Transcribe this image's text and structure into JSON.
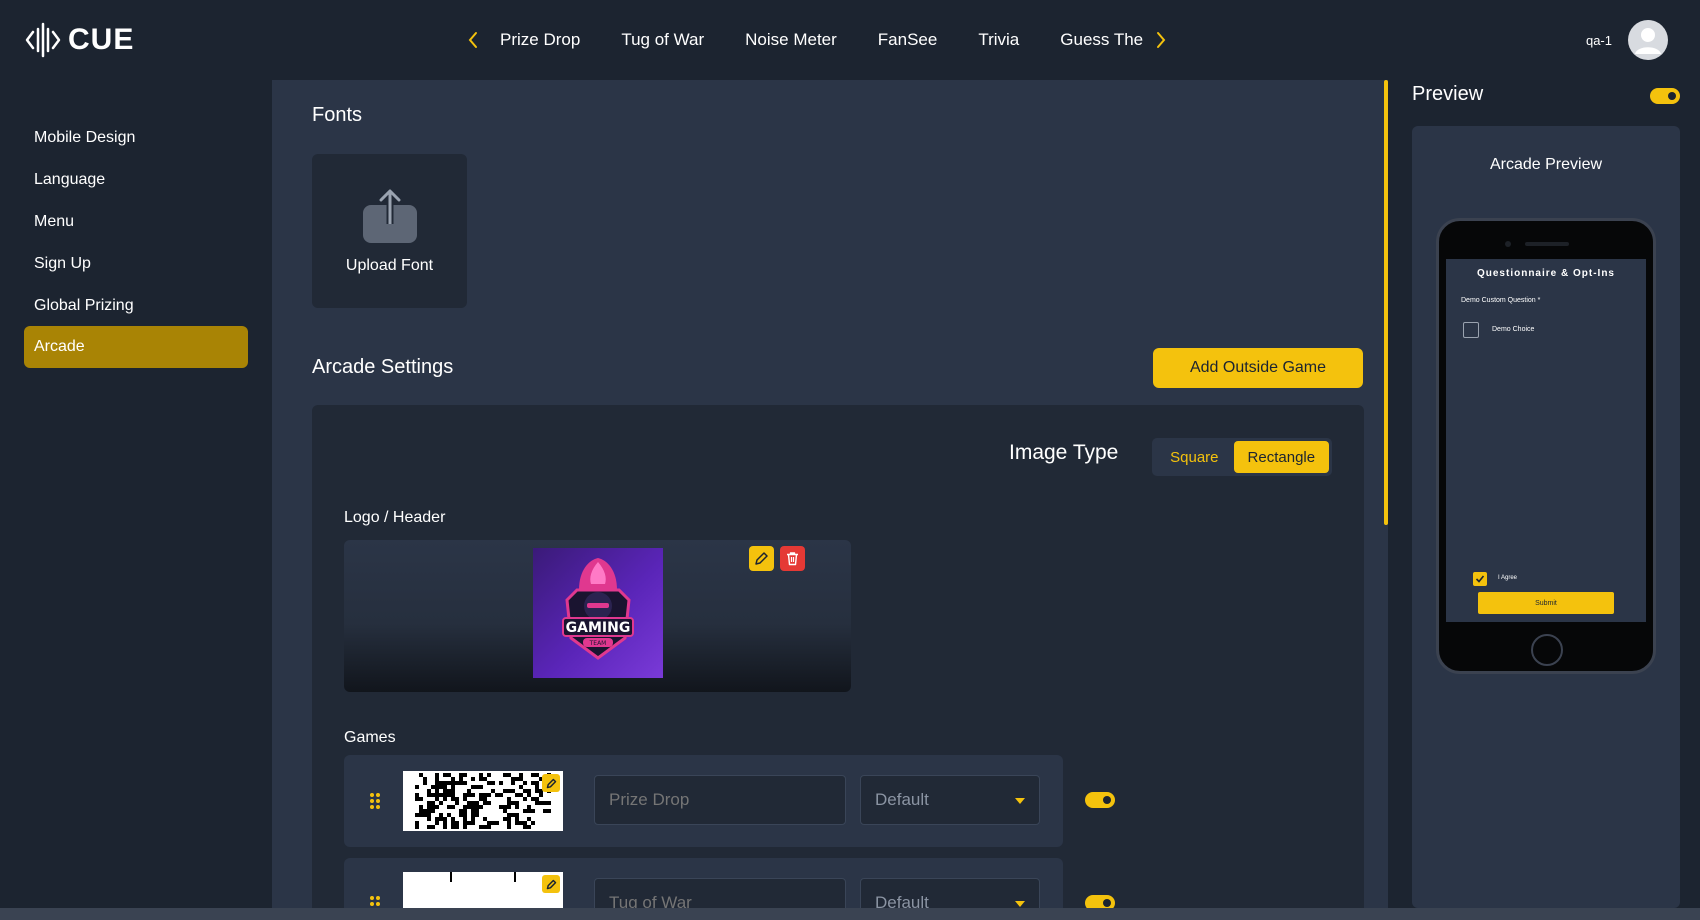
{
  "brand": {
    "name": "CUE"
  },
  "game_nav": {
    "items": [
      "Prize Drop",
      "Tug of War",
      "Noise Meter",
      "FanSee",
      "Trivia",
      "Guess The Score"
    ]
  },
  "user": {
    "name": "qa-1"
  },
  "sidebar": {
    "items": [
      {
        "label": "Mobile Design"
      },
      {
        "label": "Language"
      },
      {
        "label": "Menu"
      },
      {
        "label": "Sign Up"
      },
      {
        "label": "Global Prizing"
      },
      {
        "label": "Arcade",
        "active": true
      }
    ]
  },
  "fonts": {
    "title": "Fonts",
    "upload_label": "Upload Font"
  },
  "arcade": {
    "title": "Arcade Settings",
    "add_button": "Add Outside Game",
    "image_type": {
      "label": "Image Type",
      "options": [
        "Square",
        "Rectangle"
      ],
      "selected": "Rectangle"
    },
    "logo_header_label": "Logo / Header",
    "games_label": "Games",
    "games": [
      {
        "name_placeholder": "Prize Drop",
        "select_value": "Default",
        "enabled": true
      },
      {
        "name_placeholder": "Tug of War",
        "select_value": "Default",
        "enabled": true
      }
    ]
  },
  "preview": {
    "title": "Preview",
    "enabled": true,
    "card_title": "Arcade Preview",
    "screen": {
      "title": "Questionnaire & Opt-Ins",
      "question": "Demo Custom Question *",
      "choice": "Demo Choice",
      "agree": "I Agree",
      "submit": "Submit"
    }
  },
  "colors": {
    "accent": "#f4c20d",
    "active_sidebar": "#a98405",
    "background": "#1c2430",
    "panel": "#2b3547",
    "card": "#212936",
    "delete": "#e53935"
  }
}
